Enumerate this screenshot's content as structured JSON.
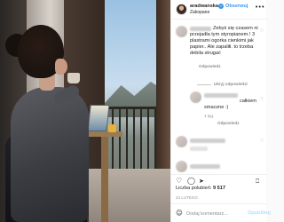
{
  "post": {
    "username": "aradwanska",
    "verified_glyph": "✓",
    "follow_label": "Obserwuj",
    "location": "Zakopane",
    "more_glyph": "•••"
  },
  "comments": [
    {
      "text": "Zebyś się czasem ni\nprzejadła tym styropianem.! 3\nplastrami ogorka cienkimi jak\npapier.. Ale zapaliłi. to trzeba\ndebila strugać",
      "reply_label": "Odpowiedz"
    },
    {
      "hide_replies_label": "Ukryj odpowiedzi"
    },
    {
      "text": "całkiem\nsmaczne :)",
      "reply_label": "Odpowiedz",
      "time": "1 tyg."
    },
    {
      "text": "",
      "time": ""
    }
  ],
  "actions": {
    "like_icon": "heart-icon",
    "comment_icon": "comment-icon",
    "share_icon": "share-icon",
    "save_icon": "bookmark-icon"
  },
  "likes": {
    "label": "Liczba polubień:",
    "count": "9 517"
  },
  "date": "23 LUTEGO",
  "add_comment": {
    "placeholder": "Dodaj komentarz...",
    "publish_label": "Opublikuj"
  },
  "colors": {
    "accent": "#3897f0",
    "text": "#262626",
    "muted": "#8e8e8e",
    "border": "#efefef"
  }
}
